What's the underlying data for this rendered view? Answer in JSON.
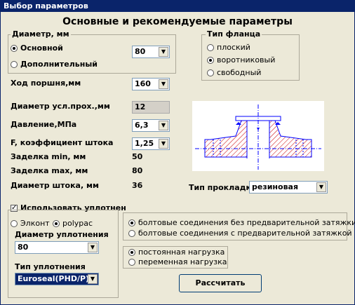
{
  "window": {
    "title": "Выбор параметров"
  },
  "heading": "Основные и рекомендуемые параметры",
  "diameter": {
    "group_label": "Диаметр, мм",
    "options": [
      "Основной",
      "Дополнительный"
    ],
    "selected": "Основной",
    "value": "80"
  },
  "flange": {
    "group_label": "Тип фланца",
    "options": [
      "плоский",
      "воротниковый",
      "свободный"
    ],
    "selected": "воротниковый"
  },
  "params": {
    "stroke_label": "Ход поршня,мм",
    "stroke_value": "160",
    "nominal_bore_label": "Диаметр усл.прох.,мм",
    "nominal_bore_value": "12",
    "pressure_label": "Давление,МПа",
    "pressure_value": "6,3",
    "rod_coef_label": "F, коэффициент штока",
    "rod_coef_value": "1,25",
    "seal_min_label": "Заделка min, мм",
    "seal_min_value": "50",
    "seal_max_label": "Заделка max, мм",
    "seal_max_value": "80",
    "rod_diam_label": "Диаметр штока, мм",
    "rod_diam_value": "36"
  },
  "gasket": {
    "label": "Тип прокладки",
    "value": "резиновая"
  },
  "sealing": {
    "use_label": "Использовать уплотнен",
    "use_checked": true,
    "options": [
      "Элконт",
      "polypac"
    ],
    "selected": "polypac",
    "diam_label": "Диаметр уплотнения",
    "diam_value": "80",
    "type_label": "Тип уплотнения",
    "type_value": "Euroseal(PHD/P)"
  },
  "bolts": {
    "options": [
      "болтовые соединения без предварительной затяжки",
      "болтовые соединения с предварительной затяжкой"
    ],
    "selected": 0
  },
  "load": {
    "options": [
      "постоянная нагрузка",
      "переменная нагрузка"
    ],
    "selected": 0
  },
  "calculate_label": "Рассчитать",
  "icons": {
    "dropdown": "chevron-down-icon",
    "drawing": "flange-drawing"
  },
  "colors": {
    "title_bar": "#0a246a",
    "dialog": "#ece9d8",
    "drawing_line": "#0000ff",
    "drawing_hatch": "#cc0000"
  }
}
